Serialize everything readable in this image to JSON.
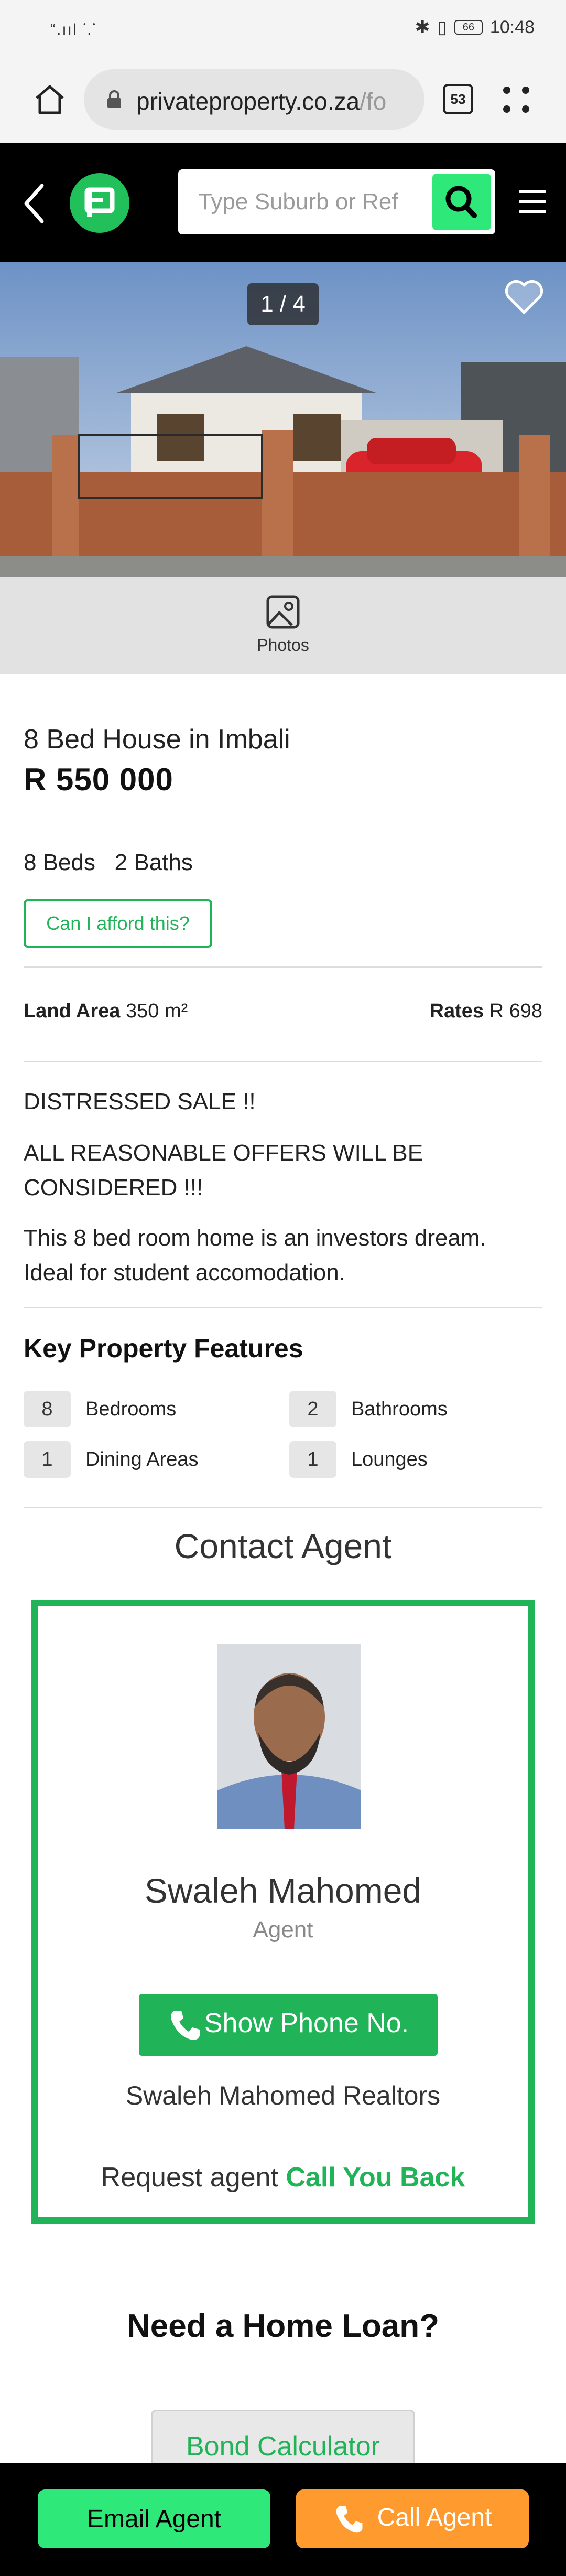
{
  "status_bar": {
    "signal": "“.ııl ⸪",
    "battery": "66",
    "time": "10:48"
  },
  "browser": {
    "url_host": "privateproperty.co.za",
    "url_path": "/fo",
    "tab_count": "53"
  },
  "header": {
    "search_placeholder": "Type Suburb or Ref"
  },
  "gallery": {
    "counter": "1 / 4",
    "photos_label": "Photos"
  },
  "listing": {
    "title": "8 Bed House in Imbali",
    "price": "R 550 000",
    "beds_baths": "8 Beds   2 Baths",
    "afford_label": "Can I afford this?",
    "land_area_label": "Land Area",
    "land_area_value": "350 m²",
    "rates_label": "Rates",
    "rates_value": "R 698",
    "description": [
      "DISTRESSED SALE !!",
      "ALL REASONABLE OFFERS WILL BE CONSIDERED !!!",
      "This 8 bed room home is an investors dream. Ideal for student accomodation."
    ]
  },
  "features": {
    "title": "Key Property Features",
    "items": [
      {
        "count": "8",
        "label": "Bedrooms"
      },
      {
        "count": "2",
        "label": "Bathrooms"
      },
      {
        "count": "1",
        "label": "Dining Areas"
      },
      {
        "count": "1",
        "label": "Lounges"
      }
    ]
  },
  "contact": {
    "title": "Contact Agent",
    "agent_name": "Swaleh Mahomed",
    "agent_role": "Agent",
    "phone_button": "Show Phone No.",
    "agency": "Swaleh Mahomed Realtors",
    "callback_prefix": "Request agent",
    "callback_link": "Call You Back"
  },
  "loan": {
    "title": "Need a Home Loan?",
    "bond_button": "Bond Calculator"
  },
  "bottom_bar": {
    "email_button": "Email Agent",
    "call_button": "Call Agent"
  },
  "colors": {
    "brand_green": "#21b357",
    "accent_green": "#2ee879",
    "call_orange": "#ff9a2e"
  }
}
